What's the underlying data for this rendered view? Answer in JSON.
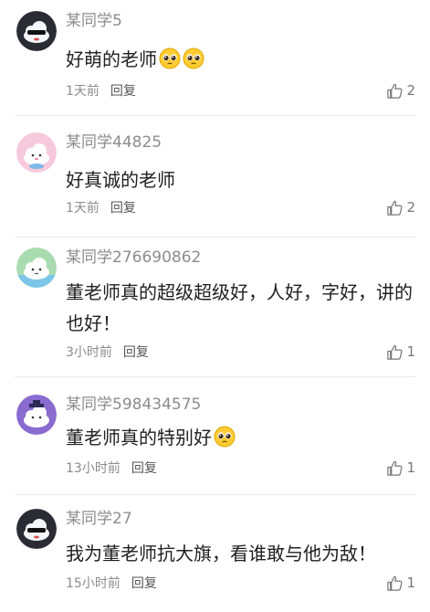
{
  "comments": [
    {
      "username": "某同学5",
      "text": "好萌的老师",
      "emojis": [
        "pleading-face-emoji",
        "pleading-face-emoji"
      ],
      "time": "1天前",
      "reply_label": "回复",
      "likes": "2",
      "avatar_icon": "dark-cloud-avatar-icon"
    },
    {
      "username": "某同学44825",
      "text": "好真诚的老师",
      "emojis": [],
      "time": "1天前",
      "reply_label": "回复",
      "likes": "2",
      "avatar_icon": "pink-cloud-avatar-icon"
    },
    {
      "username": "某同学276690862",
      "text": "董老师真的超级超级好，人好，字好，讲的也好！",
      "emojis": [],
      "time": "3小时前",
      "reply_label": "回复",
      "likes": "1",
      "avatar_icon": "green-cloud-avatar-icon"
    },
    {
      "username": "某同学598434575",
      "text": "董老师真的特别好",
      "emojis": [
        "pleading-face-emoji"
      ],
      "time": "13小时前",
      "reply_label": "回复",
      "likes": "1",
      "avatar_icon": "purple-cloud-avatar-icon"
    },
    {
      "username": "某同学27",
      "text": "我为董老师抗大旗，看谁敢与他为敌！",
      "emojis": [],
      "time": "15小时前",
      "reply_label": "回复",
      "likes": "1",
      "avatar_icon": "dark-cloud-avatar-icon"
    }
  ],
  "colors": {
    "username": "#8c8c8c",
    "content": "#1f1f1f",
    "meta": "#8c8c8c",
    "divider": "#ececec"
  }
}
